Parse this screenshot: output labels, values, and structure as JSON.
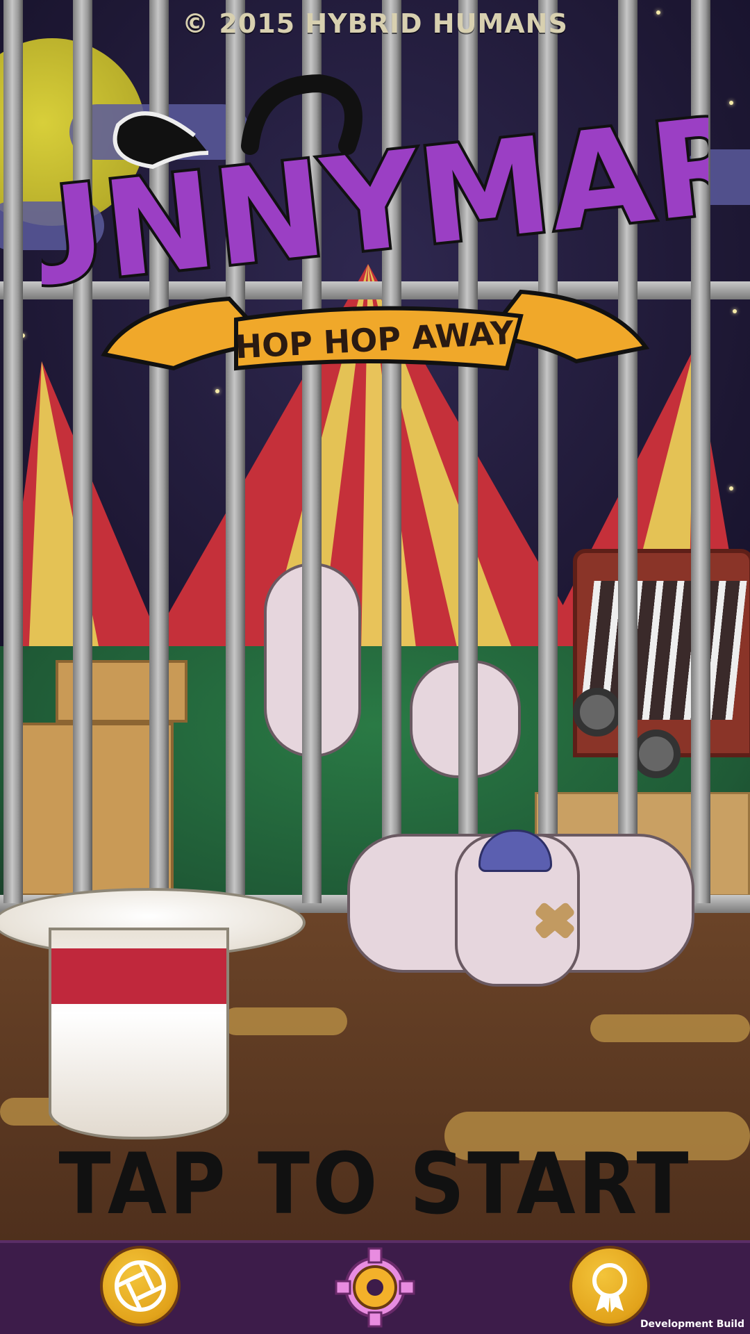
{
  "header": {
    "copyright": "© 2015 HYBRID HUMANS"
  },
  "logo": {
    "title": "BUNNYMARE",
    "subtitle": "HOP HOP AWAY"
  },
  "prompt": {
    "tap_to_start": "TAP TO START"
  },
  "toolbar": {
    "buttons": [
      {
        "icon": "aperture-icon"
      },
      {
        "icon": "gear-icon"
      },
      {
        "icon": "award-ribbon-icon"
      }
    ]
  },
  "footer": {
    "dev_build": "Development Build"
  },
  "colors": {
    "logo_purple": "#9b3fc4",
    "banner_gold": "#f0a82a",
    "toolbar_bg": "#3d1c4a",
    "button_gold": "#e2a31b"
  }
}
